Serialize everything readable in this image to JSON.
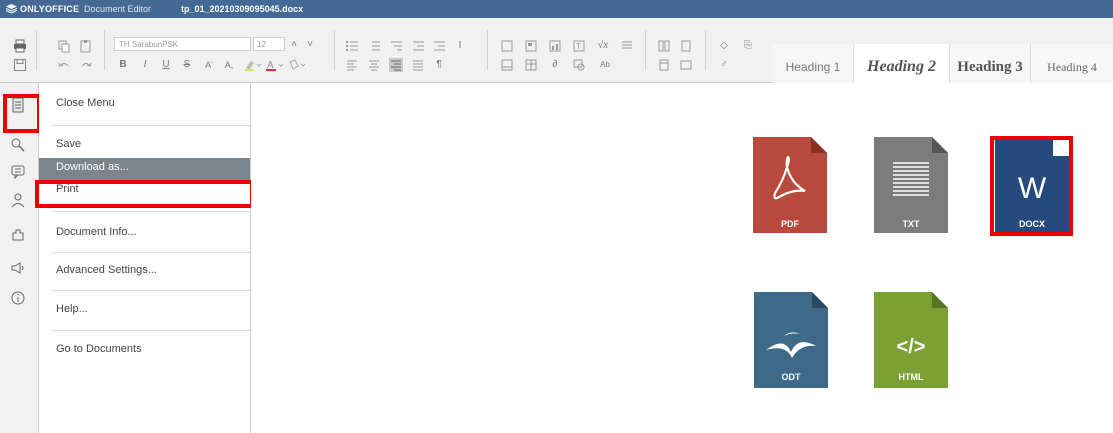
{
  "titlebar": {
    "brand": "ONLYOFFICE",
    "app": "Document Editor",
    "filename": "tp_01_20210309095045.docx"
  },
  "toolbar": {
    "font_name": "TH SarabunPSK",
    "font_size": "12",
    "styles": [
      "Heading 1",
      "Heading 2",
      "Heading 3",
      "Heading 4"
    ]
  },
  "leftbar": {
    "icons": [
      "file-menu-icon",
      "search-icon",
      "comment-icon",
      "chat-icon",
      "plugins-icon",
      "feedback-icon",
      "about-icon"
    ]
  },
  "menu": {
    "items": [
      {
        "label": "Close Menu"
      },
      {
        "label": "Save"
      },
      {
        "label": "Download as...",
        "active": true
      },
      {
        "label": "Print"
      },
      {
        "label": "Document Info..."
      },
      {
        "label": "Advanced Settings..."
      },
      {
        "label": "Help..."
      },
      {
        "label": "Go to Documents"
      }
    ]
  },
  "download_formats": [
    {
      "label": "PDF",
      "color": "#b84a3d"
    },
    {
      "label": "TXT",
      "color": "#7c7c7c"
    },
    {
      "label": "DOCX",
      "color": "#274a7c"
    },
    {
      "label": "ODT",
      "color": "#3e6a8a"
    },
    {
      "label": "HTML",
      "color": "#7aa034"
    }
  ],
  "colors": {
    "titlebar": "#446995",
    "highlight": "#e00000",
    "menu_active": "#7d858c"
  }
}
